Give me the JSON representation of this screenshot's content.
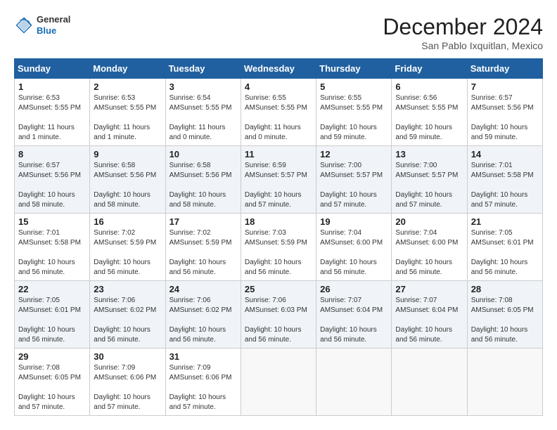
{
  "header": {
    "month_title": "December 2024",
    "location": "San Pablo Ixquitlan, Mexico",
    "logo_general": "General",
    "logo_blue": "Blue"
  },
  "calendar": {
    "days_of_week": [
      "Sunday",
      "Monday",
      "Tuesday",
      "Wednesday",
      "Thursday",
      "Friday",
      "Saturday"
    ],
    "weeks": [
      [
        {
          "day": "1",
          "sunrise": "6:53 AM",
          "sunset": "5:55 PM",
          "daylight": "11 hours and 1 minute."
        },
        {
          "day": "2",
          "sunrise": "6:53 AM",
          "sunset": "5:55 PM",
          "daylight": "11 hours and 1 minute."
        },
        {
          "day": "3",
          "sunrise": "6:54 AM",
          "sunset": "5:55 PM",
          "daylight": "11 hours and 0 minutes."
        },
        {
          "day": "4",
          "sunrise": "6:55 AM",
          "sunset": "5:55 PM",
          "daylight": "11 hours and 0 minutes."
        },
        {
          "day": "5",
          "sunrise": "6:55 AM",
          "sunset": "5:55 PM",
          "daylight": "10 hours and 59 minutes."
        },
        {
          "day": "6",
          "sunrise": "6:56 AM",
          "sunset": "5:55 PM",
          "daylight": "10 hours and 59 minutes."
        },
        {
          "day": "7",
          "sunrise": "6:57 AM",
          "sunset": "5:56 PM",
          "daylight": "10 hours and 59 minutes."
        }
      ],
      [
        {
          "day": "8",
          "sunrise": "6:57 AM",
          "sunset": "5:56 PM",
          "daylight": "10 hours and 58 minutes."
        },
        {
          "day": "9",
          "sunrise": "6:58 AM",
          "sunset": "5:56 PM",
          "daylight": "10 hours and 58 minutes."
        },
        {
          "day": "10",
          "sunrise": "6:58 AM",
          "sunset": "5:56 PM",
          "daylight": "10 hours and 58 minutes."
        },
        {
          "day": "11",
          "sunrise": "6:59 AM",
          "sunset": "5:57 PM",
          "daylight": "10 hours and 57 minutes."
        },
        {
          "day": "12",
          "sunrise": "7:00 AM",
          "sunset": "5:57 PM",
          "daylight": "10 hours and 57 minutes."
        },
        {
          "day": "13",
          "sunrise": "7:00 AM",
          "sunset": "5:57 PM",
          "daylight": "10 hours and 57 minutes."
        },
        {
          "day": "14",
          "sunrise": "7:01 AM",
          "sunset": "5:58 PM",
          "daylight": "10 hours and 57 minutes."
        }
      ],
      [
        {
          "day": "15",
          "sunrise": "7:01 AM",
          "sunset": "5:58 PM",
          "daylight": "10 hours and 56 minutes."
        },
        {
          "day": "16",
          "sunrise": "7:02 AM",
          "sunset": "5:59 PM",
          "daylight": "10 hours and 56 minutes."
        },
        {
          "day": "17",
          "sunrise": "7:02 AM",
          "sunset": "5:59 PM",
          "daylight": "10 hours and 56 minutes."
        },
        {
          "day": "18",
          "sunrise": "7:03 AM",
          "sunset": "5:59 PM",
          "daylight": "10 hours and 56 minutes."
        },
        {
          "day": "19",
          "sunrise": "7:04 AM",
          "sunset": "6:00 PM",
          "daylight": "10 hours and 56 minutes."
        },
        {
          "day": "20",
          "sunrise": "7:04 AM",
          "sunset": "6:00 PM",
          "daylight": "10 hours and 56 minutes."
        },
        {
          "day": "21",
          "sunrise": "7:05 AM",
          "sunset": "6:01 PM",
          "daylight": "10 hours and 56 minutes."
        }
      ],
      [
        {
          "day": "22",
          "sunrise": "7:05 AM",
          "sunset": "6:01 PM",
          "daylight": "10 hours and 56 minutes."
        },
        {
          "day": "23",
          "sunrise": "7:06 AM",
          "sunset": "6:02 PM",
          "daylight": "10 hours and 56 minutes."
        },
        {
          "day": "24",
          "sunrise": "7:06 AM",
          "sunset": "6:02 PM",
          "daylight": "10 hours and 56 minutes."
        },
        {
          "day": "25",
          "sunrise": "7:06 AM",
          "sunset": "6:03 PM",
          "daylight": "10 hours and 56 minutes."
        },
        {
          "day": "26",
          "sunrise": "7:07 AM",
          "sunset": "6:04 PM",
          "daylight": "10 hours and 56 minutes."
        },
        {
          "day": "27",
          "sunrise": "7:07 AM",
          "sunset": "6:04 PM",
          "daylight": "10 hours and 56 minutes."
        },
        {
          "day": "28",
          "sunrise": "7:08 AM",
          "sunset": "6:05 PM",
          "daylight": "10 hours and 56 minutes."
        }
      ],
      [
        {
          "day": "29",
          "sunrise": "7:08 AM",
          "sunset": "6:05 PM",
          "daylight": "10 hours and 57 minutes."
        },
        {
          "day": "30",
          "sunrise": "7:09 AM",
          "sunset": "6:06 PM",
          "daylight": "10 hours and 57 minutes."
        },
        {
          "day": "31",
          "sunrise": "7:09 AM",
          "sunset": "6:06 PM",
          "daylight": "10 hours and 57 minutes."
        },
        null,
        null,
        null,
        null
      ]
    ]
  }
}
